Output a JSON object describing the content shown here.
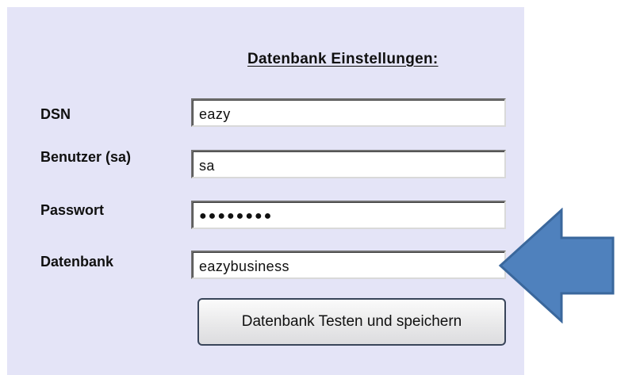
{
  "section": {
    "title": "Datenbank Einstellungen:"
  },
  "form": {
    "dsn_label": "DSN",
    "dsn_value": "eazy",
    "user_label": "Benutzer (sa)",
    "user_value": "sa",
    "password_label": "Passwort",
    "password_mask": "●●●●●●●●",
    "database_label": "Datenbank",
    "database_value": "eazybusiness"
  },
  "actions": {
    "test_save_label": "Datenbank Testen und speichern"
  },
  "colors": {
    "panel_background": "#e4e4f7",
    "arrow_fill": "#4f81bd",
    "arrow_stroke": "#3a679c"
  },
  "icons": {
    "annotation": "left-arrow-icon"
  }
}
